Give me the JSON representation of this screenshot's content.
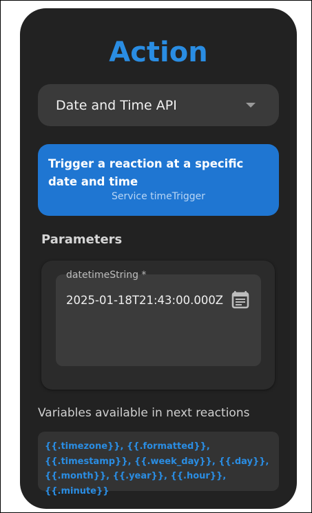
{
  "title": "Action",
  "service_select": {
    "selected": "Date and Time API"
  },
  "trigger": {
    "title": "Trigger a reaction at a specific date and time",
    "subtitle": "Service timeTrigger"
  },
  "parameters": {
    "heading": "Parameters",
    "fields": [
      {
        "label": "datetimeString *",
        "value": "2025-01-18T21:43:00.000Z"
      }
    ]
  },
  "variables": {
    "heading": "Variables available in next reactions",
    "text": "{{.timezone}}, {{.formatted}}, {{.timestamp}}, {{.week_day}}, {{.day}}, {{.month}}, {{.year}}, {{.hour}}, {{.minute}}"
  },
  "colors": {
    "accent": "#2a8de3",
    "card": "#1f76d2",
    "panel": "#222222"
  },
  "icons": {
    "dropdown": "chevron-down-icon",
    "date_picker": "calendar-icon"
  }
}
